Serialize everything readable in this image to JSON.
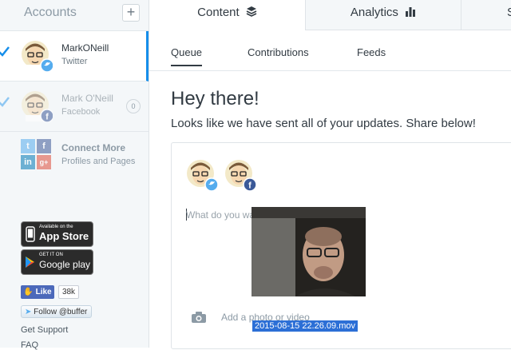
{
  "sidebar": {
    "title": "Accounts",
    "add_symbol": "+",
    "accounts": [
      {
        "name": "MarkONeill",
        "network": "Twitter"
      },
      {
        "name": "Mark O'Neill",
        "network": "Facebook",
        "count": "0"
      }
    ],
    "connect": {
      "title": "Connect More",
      "subtitle": "Profiles and Pages"
    },
    "app_store": {
      "small": "Available on the",
      "big": "App Store"
    },
    "google_play": {
      "small": "GET IT ON",
      "big": "Google play"
    },
    "like": {
      "label": "Like",
      "count": "38k"
    },
    "follow": "Follow @buffer",
    "links": [
      "Get Support",
      "FAQ"
    ]
  },
  "top_tabs": [
    {
      "label": "Content",
      "icon": "layers-icon"
    },
    {
      "label": "Analytics",
      "icon": "bar-chart-icon"
    }
  ],
  "subtabs": [
    "Queue",
    "Contributions",
    "Feeds"
  ],
  "main": {
    "heading": "Hey there!",
    "subheading": "Looks like we have sent all of your updates. Share below!"
  },
  "composer": {
    "placeholder": "What do you want to share?",
    "add_media": "Add a photo or video",
    "dragged_file": "2015-08-15 22.26.09.mov"
  },
  "colors": {
    "accent": "#168eea",
    "twitter": "#55acee",
    "facebook": "#3b5998",
    "sidebar_bg": "#f4f7f9"
  }
}
